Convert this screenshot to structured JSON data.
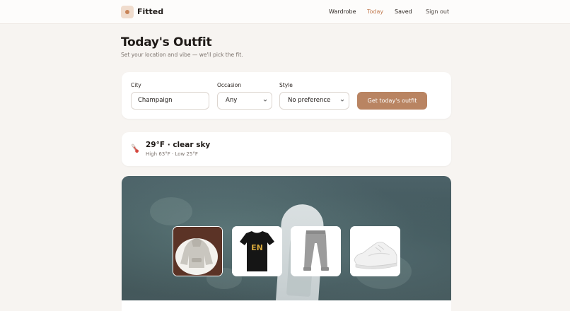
{
  "nav": {
    "brand": "Fitted",
    "links": [
      "Wardrobe",
      "Today",
      "Saved",
      "Sign out"
    ]
  },
  "page": {
    "title": "Today's Outfit",
    "subtitle": "Set your location and vibe — we'll pick the fit."
  },
  "form": {
    "city_label": "City",
    "city_value": "Champaign",
    "occasion_label": "Occasion",
    "occasion_value": "Any",
    "style_label": "Style",
    "style_value": "No preference",
    "submit_label": "Get today's outfit"
  },
  "weather": {
    "summary": "29°F · clear sky",
    "detail": "High 63°F · Low 25°F",
    "icon": "thermometer-icon"
  },
  "outfit": {
    "items": [
      {
        "name": "hoodie",
        "icon": "hoodie-image"
      },
      {
        "name": "t-shirt",
        "icon": "tshirt-image",
        "print": "EN"
      },
      {
        "name": "sweatpants",
        "icon": "sweatpants-image"
      },
      {
        "name": "sneakers",
        "icon": "sneaker-image"
      }
    ]
  },
  "colors": {
    "accent": "#c0794f",
    "button": "#b98462",
    "background": "#f7f4f1"
  }
}
